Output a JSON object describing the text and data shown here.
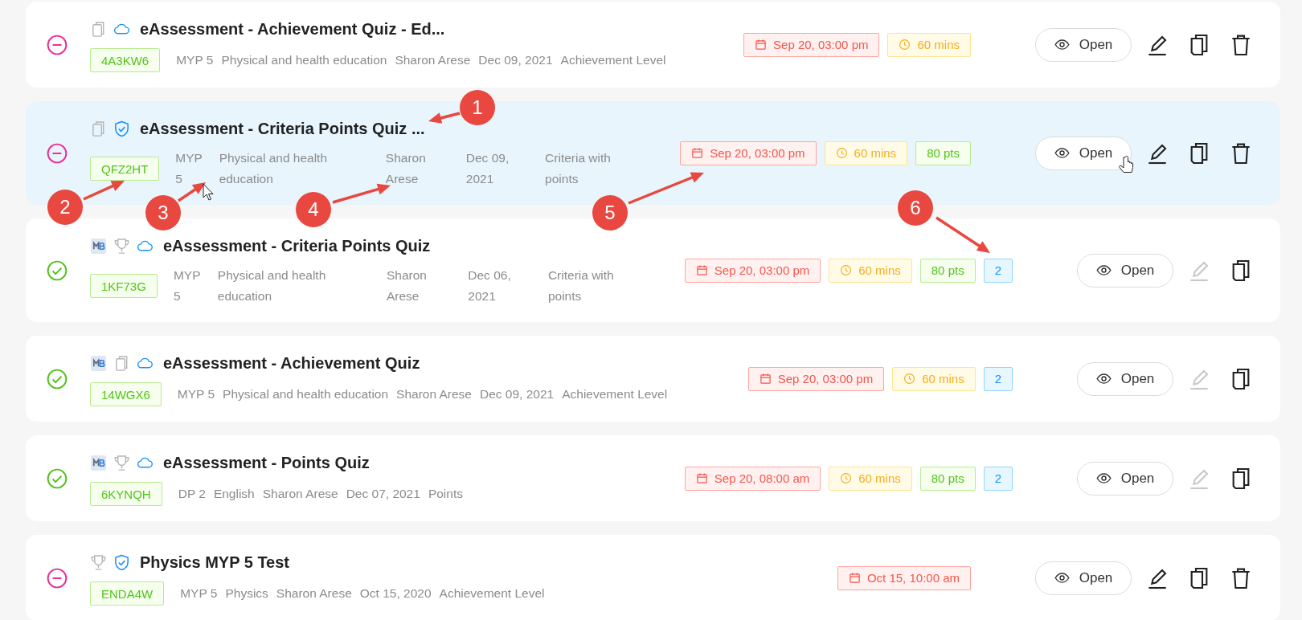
{
  "cards": [
    {
      "completed": false,
      "selected": false,
      "icons": [
        {
          "kind": "copy"
        },
        {
          "kind": "cloud"
        }
      ],
      "title": "eAssessment - Achievement Quiz - Ed...",
      "code": "4A3KW6",
      "meta": [
        "MYP 5",
        "Physical and health education",
        "Sharon Arese",
        "Dec 09, 2021",
        "Achievement Level"
      ],
      "tags": [
        {
          "kind": "date",
          "text": "Sep 20, 03:00 pm"
        },
        {
          "kind": "duration",
          "text": "60 mins"
        }
      ],
      "open_label": "Open",
      "edit_disabled": false,
      "deletable": true
    },
    {
      "completed": false,
      "selected": true,
      "icons": [
        {
          "kind": "copy"
        },
        {
          "kind": "shield"
        }
      ],
      "title": "eAssessment - Criteria Points Quiz ...",
      "code": "QFZ2HT",
      "meta": [
        "MYP 5",
        "Physical and health education",
        "Sharon Arese",
        "Dec 09, 2021",
        "Criteria with points"
      ],
      "tags": [
        {
          "kind": "date",
          "text": "Sep 20, 03:00 pm"
        },
        {
          "kind": "duration",
          "text": "60 mins"
        },
        {
          "kind": "points",
          "text": "80 pts"
        }
      ],
      "open_label": "Open",
      "edit_disabled": false,
      "deletable": true
    },
    {
      "completed": true,
      "selected": false,
      "icons": [
        {
          "kind": "mb"
        },
        {
          "kind": "trophy"
        },
        {
          "kind": "cloud"
        }
      ],
      "title": "eAssessment - Criteria Points Quiz",
      "code": "1KF73G",
      "meta": [
        "MYP 5",
        "Physical and health education",
        "Sharon Arese",
        "Dec 06, 2021",
        "Criteria with points"
      ],
      "tags": [
        {
          "kind": "date",
          "text": "Sep 20, 03:00 pm"
        },
        {
          "kind": "duration",
          "text": "60 mins"
        },
        {
          "kind": "points",
          "text": "80 pts"
        },
        {
          "kind": "count",
          "text": "2"
        }
      ],
      "open_label": "Open",
      "edit_disabled": true,
      "deletable": false
    },
    {
      "completed": true,
      "selected": false,
      "icons": [
        {
          "kind": "mb"
        },
        {
          "kind": "copy"
        },
        {
          "kind": "cloud"
        }
      ],
      "title": "eAssessment - Achievement Quiz",
      "code": "14WGX6",
      "meta": [
        "MYP 5",
        "Physical and health education",
        "Sharon Arese",
        "Dec 09, 2021",
        "Achievement Level"
      ],
      "tags": [
        {
          "kind": "date",
          "text": "Sep 20, 03:00 pm"
        },
        {
          "kind": "duration",
          "text": "60 mins"
        },
        {
          "kind": "count",
          "text": "2"
        }
      ],
      "open_label": "Open",
      "edit_disabled": true,
      "deletable": false
    },
    {
      "completed": true,
      "selected": false,
      "icons": [
        {
          "kind": "mb"
        },
        {
          "kind": "trophy"
        },
        {
          "kind": "cloud"
        }
      ],
      "title": "eAssessment - Points Quiz",
      "code": "6KYNQH",
      "meta": [
        "DP 2",
        "English",
        "Sharon Arese",
        "Dec 07, 2021",
        "Points"
      ],
      "tags": [
        {
          "kind": "date",
          "text": "Sep 20, 08:00 am"
        },
        {
          "kind": "duration",
          "text": "60 mins"
        },
        {
          "kind": "points",
          "text": "80 pts"
        },
        {
          "kind": "count",
          "text": "2"
        }
      ],
      "open_label": "Open",
      "edit_disabled": true,
      "deletable": false
    },
    {
      "completed": false,
      "selected": false,
      "icons": [
        {
          "kind": "trophy"
        },
        {
          "kind": "shield"
        }
      ],
      "title": "Physics MYP 5 Test",
      "code": "ENDA4W",
      "meta": [
        "MYP 5",
        "Physics",
        "Sharon Arese",
        "Oct 15, 2020",
        "Achievement Level"
      ],
      "tags": [
        {
          "kind": "date",
          "text": "Oct 15, 10:00 am"
        }
      ],
      "open_label": "Open",
      "edit_disabled": false,
      "deletable": true
    }
  ],
  "annotations": [
    {
      "label": "1"
    },
    {
      "label": "2"
    },
    {
      "label": "3"
    },
    {
      "label": "4"
    },
    {
      "label": "5"
    },
    {
      "label": "6"
    }
  ]
}
